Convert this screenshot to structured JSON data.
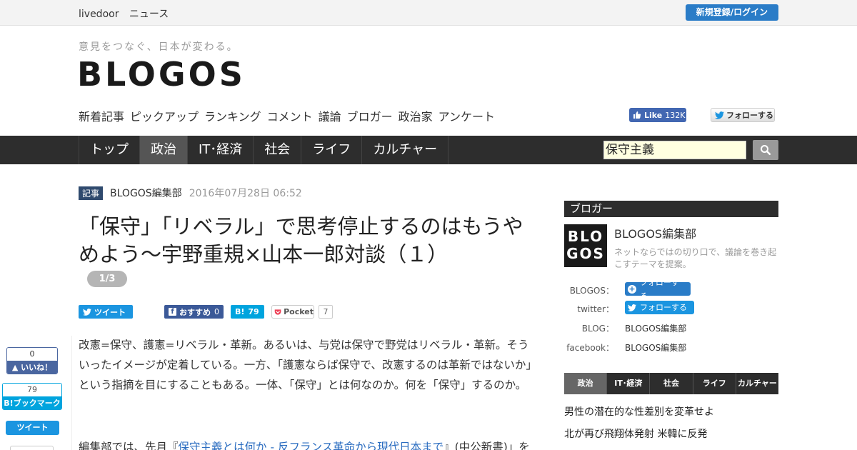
{
  "topbar": {
    "brand": "livedoor",
    "news": "ニュース",
    "login": "新規登録/ログイン"
  },
  "header": {
    "tagline": "意見をつなぐ、日本が変わる。",
    "logo": "BLOGOS",
    "subnav": [
      "新着記事",
      "ピックアップ",
      "ランキング",
      "コメント",
      "議論",
      "ブロガー",
      "政治家",
      "アンケート"
    ],
    "fb_like_label": "Like",
    "fb_like_count": "132K",
    "twitter_follow": "フォローする"
  },
  "mainnav": {
    "tabs": [
      "トップ",
      "政治",
      "IT･経済",
      "社会",
      "ライフ",
      "カルチャー"
    ],
    "active": "政治",
    "search_value": "保守主義"
  },
  "article": {
    "badge": "記事",
    "author": "BLOGOS編集部",
    "date": "2016年07月28日 06:52",
    "title": "「保守」「リベラル」で思考停止するのはもうやめよう〜宇野重規×山本一郎対談（１）",
    "page": "1/3",
    "share": {
      "tweet": "ツイート",
      "fb_recommend": "おすすめ",
      "fb_recommend_count": "0",
      "hatena_label": "B!",
      "hatena_count": "79",
      "pocket": "Pocket",
      "pocket_count": "7"
    },
    "paragraph1": "改憲=保守、護憲=リベラル・革新。あるいは、与党は保守で野党はリベラル・革新。そういったイメージが定着している。一方、「護憲ならば保守で、改憲するのは革新ではないか」という指摘を目にすることもある。一体、「保守」とは何なのか。何を「保守」するのか。",
    "paragraph2_start": "編集部では、先月『",
    "paragraph2_link": "保守主義とは何か - 反フランス革命から現代日本まで",
    "paragraph2_end": "』(中公新書)」を"
  },
  "float_share": {
    "like_count": "0",
    "like_label": "いいね！",
    "hatena_count": "79",
    "hatena_label": "B!ブックマーク",
    "tweet": "ツイート"
  },
  "sidebar": {
    "heading": "ブロガー",
    "avatar_text": "BLOGOS",
    "name": "BLOGOS編集部",
    "description": "ネットならではの切り口で、議論を巻き起こすテーマを提案。",
    "profile": [
      {
        "key": "BLOGOS：",
        "value": "フォローする"
      },
      {
        "key": "twitter：",
        "value": "フォローする"
      },
      {
        "key": "BLOG：",
        "value": "BLOGOS編集部"
      },
      {
        "key": "facebook：",
        "value": "BLOGOS編集部"
      }
    ],
    "tabs": [
      "政治",
      "IT･経済",
      "社会",
      "ライフ",
      "カルチャー"
    ],
    "active_tab": "政治",
    "headlines": [
      "男性の潜在的な性差別を変革せよ",
      "北が再び飛翔体発射 米韓に反発"
    ]
  },
  "colors": {
    "nav_bg": "#2d2d2d",
    "login_blue": "#2a7cc7",
    "twitter_blue": "#1b95e0",
    "facebook_blue": "#3b5998",
    "hatena_blue": "#00a4de",
    "search_bg": "#ffffe0",
    "link_blue": "#2a6cc0"
  }
}
